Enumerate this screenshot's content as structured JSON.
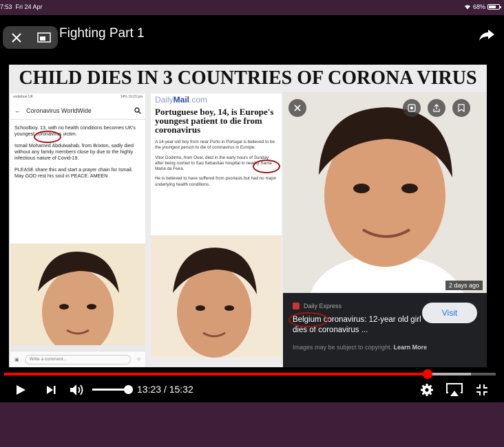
{
  "status_bar": {
    "time": "7:53",
    "date": "Fri 24 Apr",
    "battery": "68%",
    "battery_level": 0.68
  },
  "player": {
    "title": "Fighting Part 1",
    "close_icon": "close-icon",
    "pip_icon": "picture-in-picture-icon",
    "share_icon": "share-arrow-icon"
  },
  "meme": {
    "headline": "CHILD DIES IN 3 COUNTRIES OF CORONA VIRUS",
    "panel1": {
      "status_left": "vodafone UK",
      "status_right": "14% 19:23 pm",
      "header_title": "Coronavirus WorldWide",
      "paragraphs": [
        "Schoolboy, 13, with no health conditions becomes UK's youngest coronavirus victim.",
        "Ismail Mohamed Abdulwahab, from Brixton, sadly died without any family members close by due to the highly infectious nature of Covid-19.",
        "PLEASE share this and start a prayer chain for Ismail. May GOD rest his soul in PEACE. AMEEN"
      ],
      "comment_placeholder": "Write a comment..."
    },
    "panel2": {
      "logo_prefix": "Daily",
      "logo_main": "Mail",
      "logo_suffix": ".com",
      "headline": "Portuguese boy, 14, is Europe's youngest patient to die from coronavirus",
      "paragraphs": [
        "A 14-year-old boy from near Porto in Portugal is believed to be the youngest person to die of coronavirus in Europe.",
        "Vitor Godinho, from Ovar, died in the early hours of Sunday after being rushed to Sao Sebastiao hospital in nearby Santa Maria da Feira.",
        "He is believed to have suffered from psoriasis but had no major underlying health conditions."
      ]
    },
    "panel3": {
      "age_badge": "2 days ago",
      "source": "Daily Express",
      "title": "Belgium coronavirus: 12-year old girl dies of coronavirus ...",
      "visit_label": "Visit",
      "note": "Images may be subject to copyright.",
      "learn_more": "Learn More"
    }
  },
  "playback": {
    "current": "13:23",
    "total": "15:32",
    "time_display": "13:23 / 15:32",
    "progress_fraction": 0.861,
    "buffered_fraction": 0.95,
    "volume_fraction": 1.0
  },
  "colors": {
    "accent": "#ff0000",
    "frame": "#3d1f39",
    "circle": "#a01818"
  }
}
